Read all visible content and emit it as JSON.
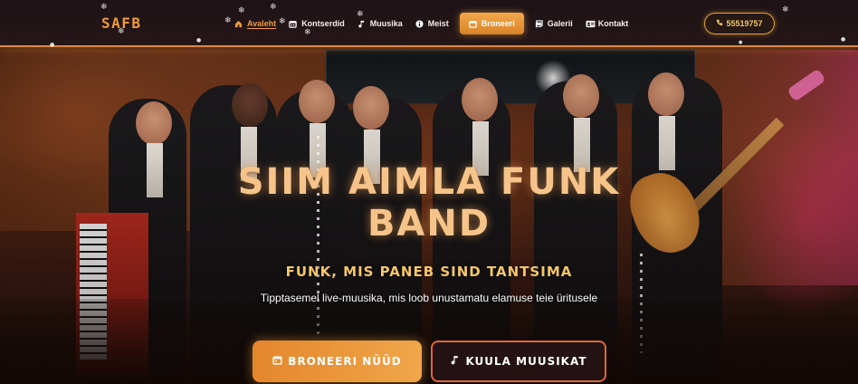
{
  "logo": "SAFB",
  "nav": {
    "items": [
      {
        "label": "Avaleht",
        "icon": "home-icon",
        "active": true
      },
      {
        "label": "Kontserdid",
        "icon": "calendar-icon",
        "active": false
      },
      {
        "label": "Muusika",
        "icon": "music-note-icon",
        "active": false
      },
      {
        "label": "Meist",
        "icon": "info-icon",
        "active": false
      }
    ],
    "book_label": "Broneeri",
    "book_icon": "calendar-icon",
    "items_after": [
      {
        "label": "Galerii",
        "icon": "images-icon"
      },
      {
        "label": "Kontakt",
        "icon": "contact-card-icon"
      }
    ],
    "phone": "55519757",
    "phone_icon": "phone-icon"
  },
  "hero": {
    "title_line1": "SIIM AIMLA FUNK",
    "title_line2": "BAND",
    "tagline": "FUNK, MIS PANEB SIND TANTSIMA",
    "subtitle": "Tipptasemel live-muusika, mis loob unustamatu elamuse teie üritusele",
    "cta_primary": "BRONEERI NÜÜD",
    "cta_primary_icon": "calendar-icon",
    "cta_secondary": "KUULA MUUSIKAT",
    "cta_secondary_icon": "music-note-icon"
  },
  "colors": {
    "accent": "#f29a3c",
    "gold": "#f3c66a",
    "title": "#f6c48a",
    "secondary_border": "#e0663a"
  }
}
